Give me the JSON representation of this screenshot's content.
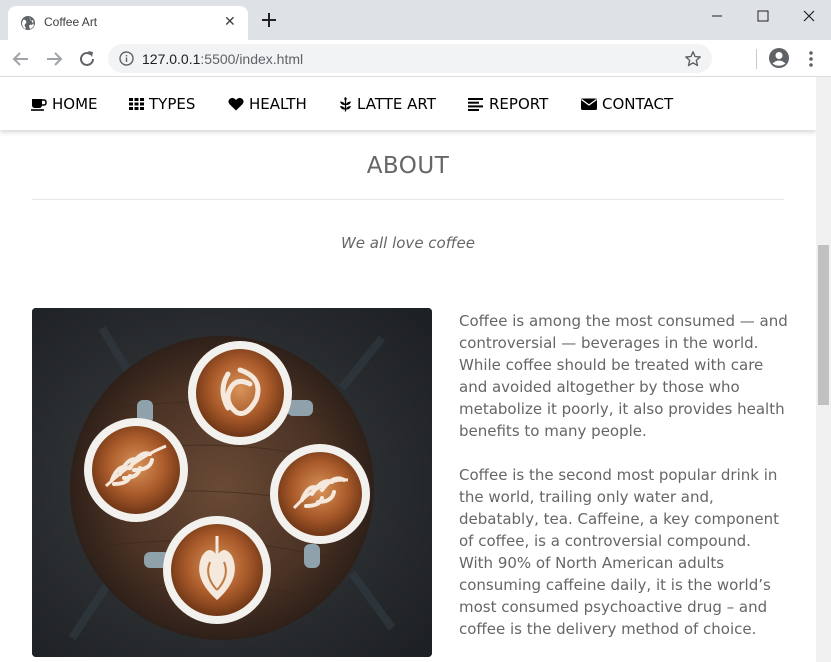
{
  "browser": {
    "tab_title": "Coffee Art",
    "tab_close": "✕",
    "url_host": "127.0.0.1",
    "url_rest": ":5500/index.html"
  },
  "nav": {
    "items": [
      {
        "label": "HOME",
        "icon": "coffee-cup-icon"
      },
      {
        "label": "TYPES",
        "icon": "grid-icon"
      },
      {
        "label": "HEALTH",
        "icon": "heart-icon"
      },
      {
        "label": "LATTE ART",
        "icon": "leaf-icon"
      },
      {
        "label": "REPORT",
        "icon": "align-left-icon"
      },
      {
        "label": "CONTACT",
        "icon": "envelope-icon"
      }
    ]
  },
  "about": {
    "title": "ABOUT",
    "tagline": "We all love coffee",
    "image_description": "",
    "paragraphs": [
      "Coffee is among the most consumed — and controversial — beverages in the world. While coffee should be treated with care and avoided altogether by those who metabolize it poorly, it also provides health benefits to many people.",
      "Coffee is the second most popular drink in the world, trailing only water and, debatably, tea. Caffeine, a key component of coffee, is a controversial compound. With 90% of North American adults consuming caffeine daily, it is the world’s most consumed psychoactive drug – and coffee is the delivery method of choice."
    ]
  },
  "colors": {
    "text_muted": "#666666",
    "chrome_bg": "#dee1e6"
  }
}
